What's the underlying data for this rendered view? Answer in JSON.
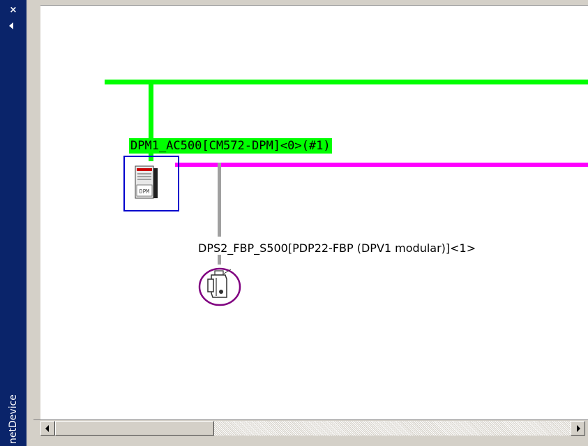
{
  "side_panel": {
    "title": "netDevice",
    "close_glyph": "×",
    "icons": [
      "close-icon",
      "collapse-arrow-icon"
    ],
    "background_color": "#0a246a"
  },
  "network": {
    "master": {
      "label": "DPM1_AC500[CM572-DPM]<0>(#1)",
      "icon": "dp-master-device-icon",
      "icon_text": "DPM",
      "highlight_color": "#00ff00",
      "selected_border_color": "#0000cc"
    },
    "slave": {
      "label": "DPS2_FBP_S500[PDP22-FBP (DPV1 modular)]<1>",
      "icon": "dp-slave-device-icon"
    },
    "bus_colors": {
      "upper_bus": "#00ff00",
      "master_bus": "#ff00ff",
      "slave_drop": "#a0a0a0"
    }
  },
  "scrollbar": {
    "left_icon": "scroll-left-arrow-icon",
    "right_icon": "scroll-right-arrow-icon"
  }
}
